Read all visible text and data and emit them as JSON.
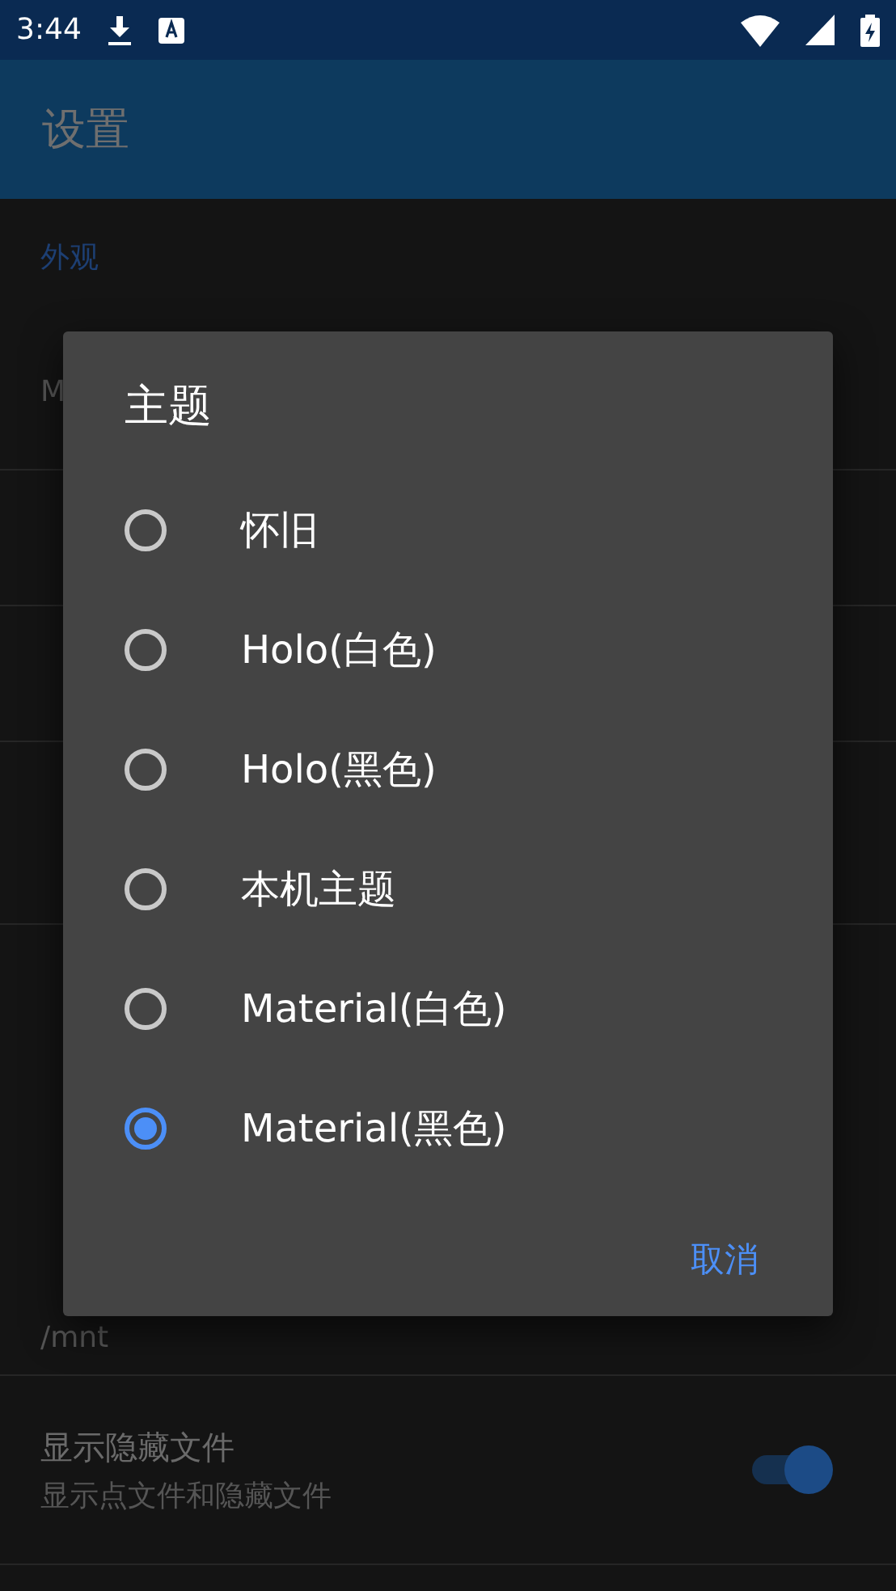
{
  "status_bar": {
    "time": "3:44"
  },
  "app_bar": {
    "title": "设置"
  },
  "settings": [
    {
      "kind": "header",
      "title": "外观"
    },
    {
      "kind": "row",
      "subtitle": "M"
    },
    {
      "kind": "row"
    },
    {
      "kind": "row"
    },
    {
      "kind": "row"
    },
    {
      "kind": "gap"
    },
    {
      "kind": "header"
    },
    {
      "kind": "row",
      "subtitle": "/mnt"
    },
    {
      "kind": "switch",
      "title": "显示隐藏文件",
      "subtitle": "显示点文件和隐藏文件",
      "on": true
    }
  ],
  "dialog": {
    "title": "主题",
    "options": [
      {
        "label": "怀旧",
        "selected": false
      },
      {
        "label": "Holo(白色)",
        "selected": false
      },
      {
        "label": "Holo(黑色)",
        "selected": false
      },
      {
        "label": "本机主题",
        "selected": false
      },
      {
        "label": "Material(白色)",
        "selected": false
      },
      {
        "label": "Material(黑色)",
        "selected": true
      }
    ],
    "button": "取消"
  }
}
